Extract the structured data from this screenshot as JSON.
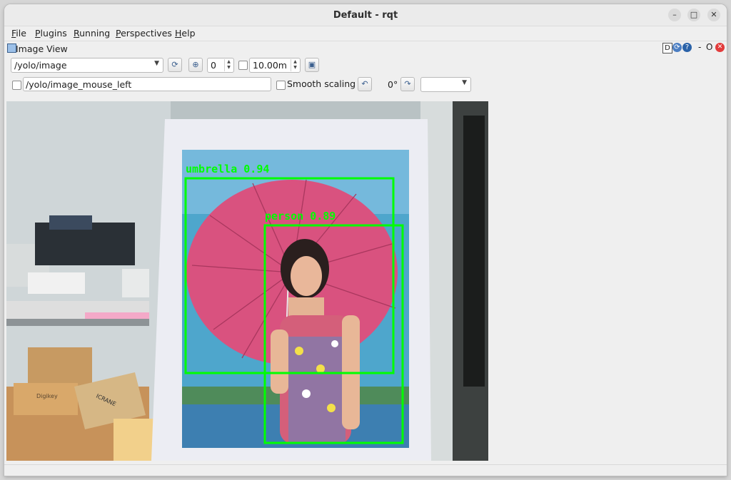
{
  "window": {
    "title": "Default - rqt",
    "controls": [
      "minimize",
      "maximize",
      "close"
    ]
  },
  "menubar": [
    {
      "label": "File",
      "mnemonic": "F",
      "rest": "ile"
    },
    {
      "label": "Plugins",
      "mnemonic": "P",
      "rest": "lugins"
    },
    {
      "label": "Running",
      "mnemonic": "R",
      "rest": "unning"
    },
    {
      "label": "Perspectives",
      "mnemonic": "P",
      "rest": "erspectives"
    },
    {
      "label": "Help",
      "mnemonic": "H",
      "rest": "elp"
    }
  ],
  "dock": {
    "title": "Image View",
    "right_controls": [
      "D",
      "reload-icon",
      "help-icon",
      "-",
      "O",
      "close-icon"
    ]
  },
  "toolbar1": {
    "topic": "/yolo/image",
    "spin_value": "0",
    "duration": "10.00m",
    "duration_checked": false
  },
  "toolbar2": {
    "mouse_topic": "/yolo/image_mouse_left",
    "mouse_checked": false,
    "smooth_label": "Smooth scaling",
    "smooth_checked": false,
    "rotation": "0°",
    "color_scheme": ""
  },
  "image": {
    "detections": [
      {
        "label": "umbrella 0.94",
        "color": "#00ff00"
      },
      {
        "label": "person 0.89",
        "color": "#00ff00"
      }
    ],
    "detail_texts": [
      "Digikey",
      "ICRANE"
    ]
  },
  "colors": {
    "accent": "#3b5f8e",
    "detection": "#00ff00",
    "close_red": "#e23b3b"
  }
}
